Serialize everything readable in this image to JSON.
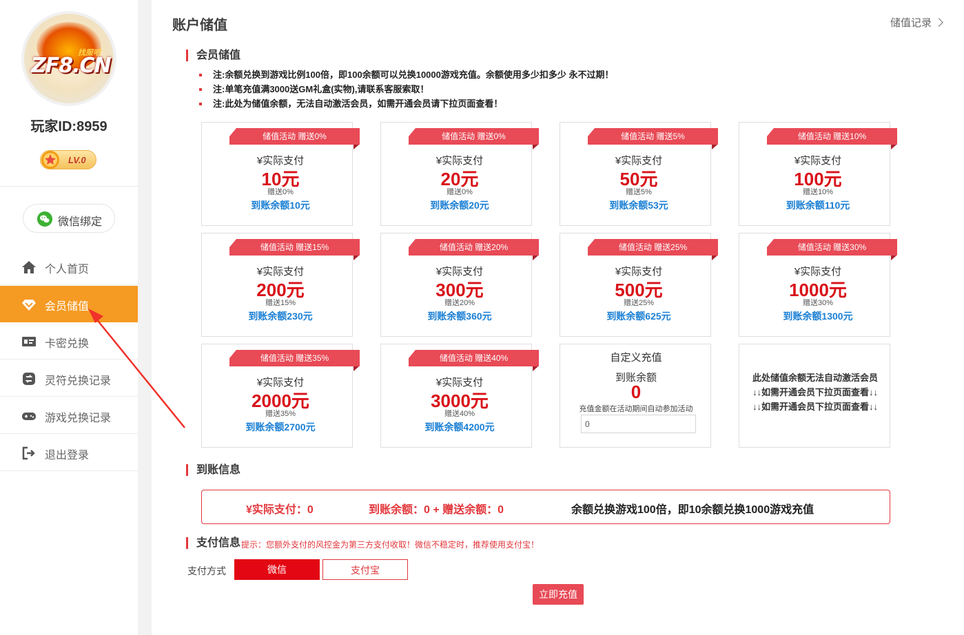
{
  "sidebar": {
    "logo_text": "ZF8.CN",
    "logo_sub": "找服吧",
    "player_id": "玩家ID:8959",
    "level": "LV.0",
    "wechat_bind": "微信绑定",
    "nav": [
      {
        "label": "个人首页",
        "icon": "home-icon",
        "active": false
      },
      {
        "label": "会员储值",
        "icon": "diamond-icon",
        "active": true
      },
      {
        "label": "卡密兑换",
        "icon": "card-icon",
        "active": false
      },
      {
        "label": "灵符兑换记录",
        "icon": "exchange-icon",
        "active": false
      },
      {
        "label": "游戏兑换记录",
        "icon": "gamepad-icon",
        "active": false
      },
      {
        "label": "退出登录",
        "icon": "logout-icon",
        "active": false
      }
    ]
  },
  "header": {
    "title": "账户储值",
    "record_link": "储值记录"
  },
  "member": {
    "section_title": "会员储值",
    "notes": [
      "注:余额兑换到游戏比例100倍，即100余额可以兑换10000游戏充值。余额使用多少扣多少 永不过期！",
      "注:单笔充值满3000送GM礼盒(实物),请联系客服索取！",
      "注:此处为储值余额，无法自动激活会员，如需开通会员请下拉页面查看！"
    ],
    "pay_label": "¥实际支付",
    "packages": [
      {
        "ribbon": "储值活动 赠送0%",
        "amount": "10元",
        "gift": "赠送0%",
        "arrive": "到账余额10元"
      },
      {
        "ribbon": "储值活动 赠送0%",
        "amount": "20元",
        "gift": "赠送0%",
        "arrive": "到账余额20元"
      },
      {
        "ribbon": "储值活动 赠送5%",
        "amount": "50元",
        "gift": "赠送5%",
        "arrive": "到账余额53元"
      },
      {
        "ribbon": "储值活动 赠送10%",
        "amount": "100元",
        "gift": "赠送10%",
        "arrive": "到账余额110元"
      },
      {
        "ribbon": "储值活动 赠送15%",
        "amount": "200元",
        "gift": "赠送15%",
        "arrive": "到账余额230元"
      },
      {
        "ribbon": "储值活动 赠送20%",
        "amount": "300元",
        "gift": "赠送20%",
        "arrive": "到账余额360元"
      },
      {
        "ribbon": "储值活动 赠送25%",
        "amount": "500元",
        "gift": "赠送25%",
        "arrive": "到账余额625元"
      },
      {
        "ribbon": "储值活动 赠送30%",
        "amount": "1000元",
        "gift": "赠送30%",
        "arrive": "到账余额1300元"
      },
      {
        "ribbon": "储值活动 赠送35%",
        "amount": "2000元",
        "gift": "赠送35%",
        "arrive": "到账余额2700元"
      },
      {
        "ribbon": "储值活动 赠送40%",
        "amount": "3000元",
        "gift": "赠送40%",
        "arrive": "到账余额4200元"
      }
    ],
    "custom": {
      "title": "自定义充值",
      "arrive_label": "到账余额",
      "arrive_value": "0",
      "hint": "充值金额在活动期间自动参加活动",
      "input_value": "0"
    },
    "notice_lines": [
      "此处储值余额无法自动激活会员",
      "↓↓如需开通会员下拉页面查看↓↓",
      "↓↓如需开通会员下拉页面查看↓↓"
    ]
  },
  "arrival": {
    "section_title": "到账信息",
    "actual_pay": "¥实际支付：0",
    "balance": "到账余额：0 + 赠送余额：0",
    "ratio_text": "余额兑换游戏100倍，即10余额兑换1000游戏充值"
  },
  "payment": {
    "section_title": "支付信息",
    "hint": "提示：您额外支付的风控金为第三方支付收取！微信不稳定时，推荐使用支付宝！",
    "method_label": "支付方式",
    "wechat": "微信",
    "alipay": "支付宝",
    "submit": "立即充值"
  },
  "colors": {
    "accent_red": "#e2373c",
    "amount_red": "#d9121a",
    "arrive_blue": "#1a7fd4",
    "active_orange": "#f59a23"
  }
}
